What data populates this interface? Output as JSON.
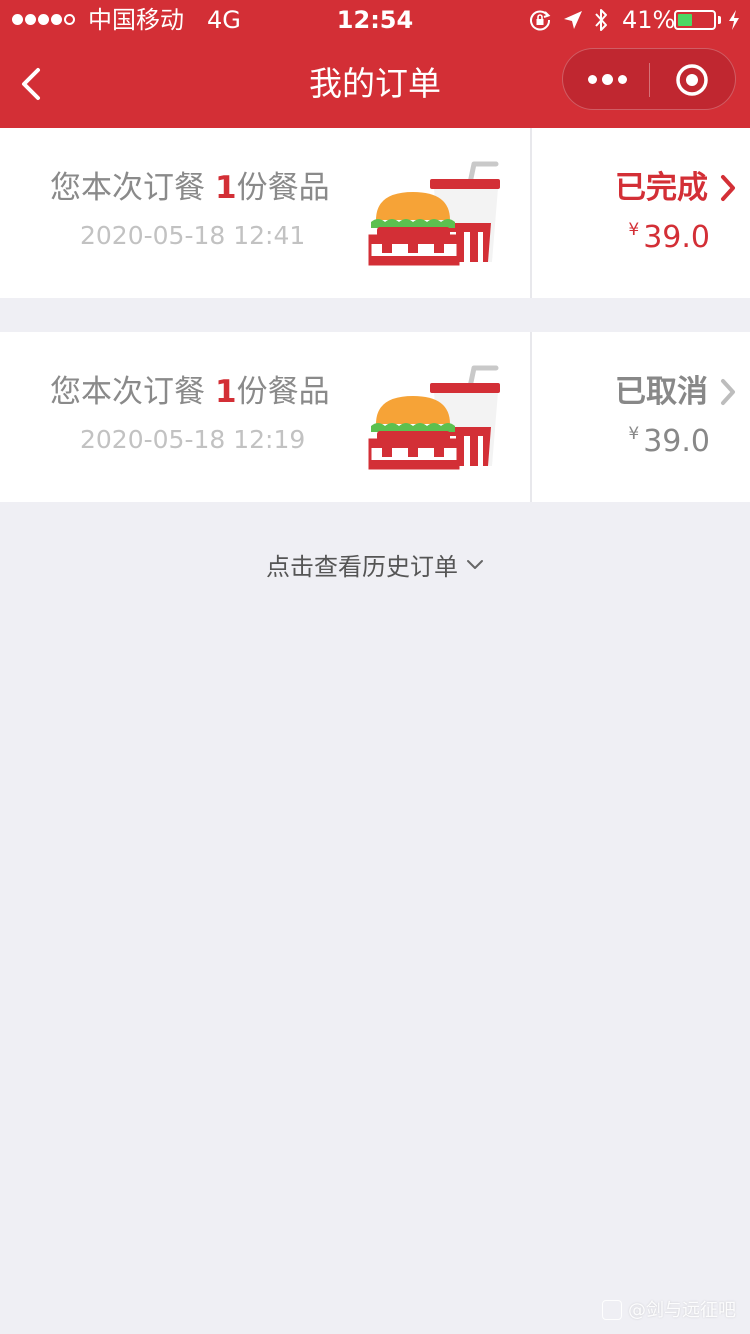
{
  "status_bar": {
    "carrier": "中国移动",
    "network": "4G",
    "time": "12:54",
    "battery_percent": "41%",
    "battery_level": 0.41,
    "signal_bars_filled": 4,
    "signal_bars_total": 5,
    "icons": [
      "signal-dots",
      "orientation-lock-icon",
      "location-arrow-icon",
      "bluetooth-icon",
      "battery-icon",
      "charging-bolt-icon"
    ]
  },
  "nav": {
    "title": "我的订单",
    "back_icon": "chevron-left-icon",
    "more_icon": "more-dots-icon",
    "close_icon": "target-circle-icon"
  },
  "orders": [
    {
      "summary_prefix": "您本次订餐",
      "quantity": "1",
      "summary_suffix": "份餐品",
      "datetime": "2020-05-18 12:41",
      "status": "已完成",
      "currency": "¥",
      "amount": "39.0",
      "status_color": "#d32f36",
      "icon": "burger-and-drink-icon"
    },
    {
      "summary_prefix": "您本次订餐",
      "quantity": "1",
      "summary_suffix": "份餐品",
      "datetime": "2020-05-18 12:19",
      "status": "已取消",
      "currency": "¥",
      "amount": "39.0",
      "status_color": "#888888",
      "icon": "burger-and-drink-icon"
    }
  ],
  "history_link": {
    "label": "点击查看历史订单",
    "icon": "chevron-down-icon"
  },
  "watermark": {
    "text": "@剑与远征吧"
  },
  "colors": {
    "brand_red": "#d32f36",
    "page_background": "#efeff4",
    "battery_green": "#4cd964"
  }
}
